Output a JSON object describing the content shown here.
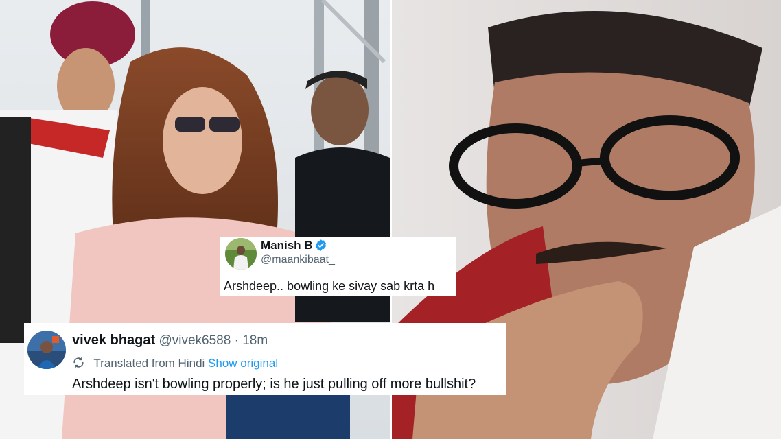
{
  "tweet_manish": {
    "name": "Manish B",
    "handle": "@maankibaat_",
    "text": "Arshdeep.. bowling ke sivay sab krta h",
    "verified": true
  },
  "tweet_vivek": {
    "name": "vivek bhagat",
    "handle": "@vivek6588",
    "separator": "·",
    "time": "18m",
    "translated_label": "Translated from Hindi",
    "show_original": "Show original",
    "text": "Arshdeep isn't bowling properly; is he just pulling off more bullshit?"
  },
  "colors": {
    "verified_blue": "#1d9bf0",
    "link_blue": "#1d9bf0",
    "muted_text": "#536471",
    "text": "#0f1419"
  },
  "icons": [
    "verified-badge-icon",
    "translate-icon"
  ]
}
